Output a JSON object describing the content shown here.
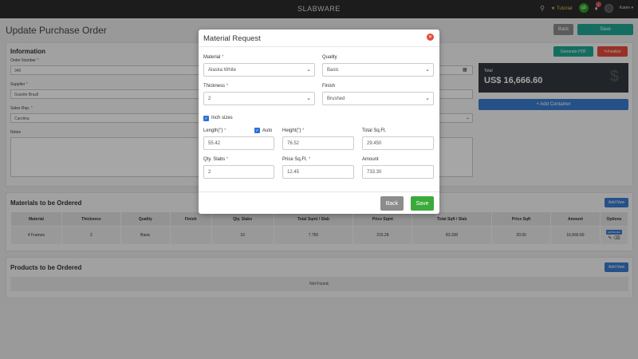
{
  "topbar": {
    "brand": "SLABWARE",
    "tutorial_label": "Tutorial",
    "qb_label": "qb",
    "notif_count": "1",
    "user_name": "Karen"
  },
  "page": {
    "title": "Update Purchase Order",
    "back_label": "Back",
    "save_label": "Save"
  },
  "info": {
    "title": "Information",
    "order_number_label": "Order Number",
    "order_number": "340",
    "supplier_label": "Supplier",
    "supplier": "Granite Brazil",
    "sales_rep_label": "Sales Rep.",
    "sales_rep": "Carolina",
    "notes_label": "Notes"
  },
  "side": {
    "generate_pdf_label": "Generate PDF",
    "finalize_label": "Finalize",
    "total_label": "Total",
    "total_value": "US$ 16,666.60",
    "add_container_label": "+ Add Container"
  },
  "materials": {
    "title": "Materials to be Ordered",
    "add_new_label": "Add New",
    "columns": [
      "Material",
      "Thickness",
      "Quality",
      "Finish",
      "Qty. Slabs",
      "Total Sqmt / Slab",
      "Price Sqmt",
      "Total Sqft / Slab",
      "Price Sqft",
      "Amount",
      "Options"
    ],
    "rows": [
      [
        "4 Frames",
        "2",
        "Basic",
        "",
        "10",
        "7.750",
        "215.28",
        "83.330",
        "20.00",
        "16,666.60"
      ]
    ],
    "edit_bundle_label": "Edit Bundle"
  },
  "products": {
    "title": "Products to be Ordered",
    "add_new_label": "Add New",
    "empty_text": "Not Found."
  },
  "modal": {
    "title": "Material Request",
    "material_label": "Material",
    "material_value": "Alaska White",
    "quality_label": "Quality",
    "quality_value": "Basic",
    "thickness_label": "Thickness",
    "thickness_value": "2",
    "finish_label": "Finish",
    "finish_value": "Brushed",
    "inch_sizes_label": "Inch sizes",
    "length_label": "Length(\")",
    "auto_label": "Auto",
    "length_value": "55.42",
    "height_label": "Height(\")",
    "height_value": "76.52",
    "total_sqft_label": "Total Sq.Ft.",
    "total_sqft_value": "29.450",
    "qty_slabs_label": "Qty. Slabs",
    "qty_slabs_value": "2",
    "price_sqft_label": "Price Sq.Ft.",
    "price_sqft_value": "12.45",
    "amount_label": "Amount",
    "amount_value": "733.30",
    "back_label": "Back",
    "save_label": "Save"
  },
  "colors": {
    "topbar": "#2b2b2b",
    "teal": "#21a896",
    "danger": "#e84b3a",
    "primary": "#3a7dd1",
    "success": "#3aaa3a"
  }
}
